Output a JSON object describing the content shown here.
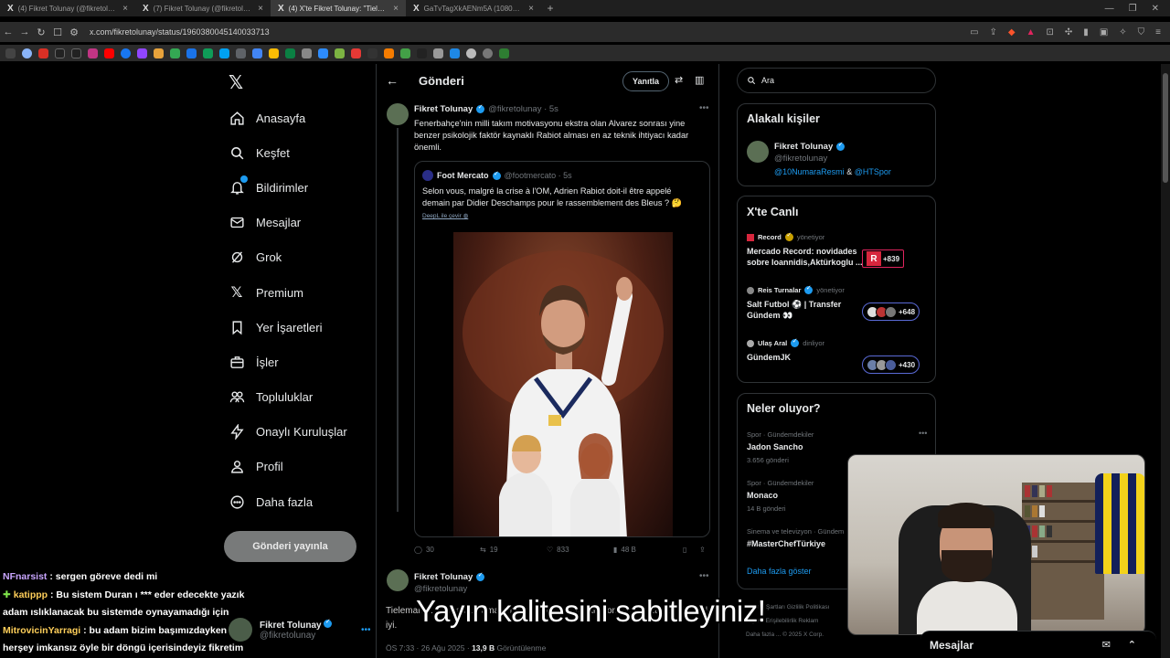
{
  "browser": {
    "tabs": [
      {
        "label": "(4) Fikret Tolunay (@fikretolunay) / X",
        "active": false
      },
      {
        "label": "(7) Fikret Tolunay (@fikretolunay) / X",
        "active": false
      },
      {
        "label": "(4) X'te Fikret Tolunay: \"Tieleman",
        "active": true
      },
      {
        "label": "GaTvTagXkAENm5A (1080×1350)",
        "active": false
      }
    ],
    "url": "x.com/fikretolunay/status/1960380045140033713"
  },
  "nav": {
    "items": [
      {
        "label": "Anasayfa",
        "icon": "home-icon"
      },
      {
        "label": "Keşfet",
        "icon": "search-icon"
      },
      {
        "label": "Bildirimler",
        "icon": "bell-icon"
      },
      {
        "label": "Mesajlar",
        "icon": "mail-icon"
      },
      {
        "label": "Grok",
        "icon": "grok-icon"
      },
      {
        "label": "Premium",
        "icon": "x-icon"
      },
      {
        "label": "Yer İşaretleri",
        "icon": "bookmark-icon"
      },
      {
        "label": "İşler",
        "icon": "briefcase-icon"
      },
      {
        "label": "Topluluklar",
        "icon": "people-icon"
      },
      {
        "label": "Onaylı Kuruluşlar",
        "icon": "lightning-icon"
      },
      {
        "label": "Profil",
        "icon": "person-icon"
      },
      {
        "label": "Daha fazla",
        "icon": "more-circle-icon"
      }
    ],
    "post_button": "Gönderi yayınla"
  },
  "account": {
    "name": "Fikret Tolunay",
    "handle": "@fikretolunay"
  },
  "header": {
    "title": "Gönderi",
    "reply_label": "Yanıtla"
  },
  "tweet": {
    "name": "Fikret Tolunay",
    "meta": "@fikretolunay · 5s",
    "text": "Fenerbahçe'nin milli takım motivasyonu ekstra olan Alvarez sonrası yine benzer psikolojik faktör kaynaklı Rabiot alması en az teknik ihtiyacı kadar önemli.",
    "quote": {
      "name": "Foot Mercato",
      "meta": "@footmercato · 5s",
      "text": "Selon vous, malgré la crise à l'OM, Adrien Rabiot doit-il être appelé demain par Didier Deschamps pour le rassemblement des Bleus ? 🤔",
      "deepl": "DeepL ile çevir"
    },
    "actions": {
      "replies": "30",
      "retweets": "19",
      "likes": "833",
      "views": "48 B"
    }
  },
  "tweet2": {
    "name": "Fikret Tolunay",
    "handle": "@fikretolunay",
    "text": "Tieleman ... Mercato ... ama anlatmaya çalıştığım aklıyor. Bence Rabiot olur o da iyi.",
    "time": "ÖS 7:33 · 26 Ağu 2025 ·",
    "views": "13,9 B",
    "views_label": "Görüntülenme"
  },
  "search": {
    "placeholder": "Ara"
  },
  "related": {
    "title": "Alakalı kişiler",
    "name": "Fikret Tolunay",
    "handle": "@fikretolunay",
    "link1": "@10NumaraResmi",
    "amp": "&",
    "link2": "@HTSpor"
  },
  "live": {
    "title": "X'te Canlı",
    "items": [
      {
        "host": "Record",
        "status": "yönetiyor",
        "title": "Mercado Record: novidades sobre Ioannidis,Aktürkoglu ...",
        "count": "+839"
      },
      {
        "host": "Reis Turnalar",
        "status": "yönetiyor",
        "title": "Salt Futbol ⚽ | Transfer Gündem 👀",
        "count": "+648"
      },
      {
        "host": "Ulaş Aral",
        "status": "dinliyor",
        "title": "GündemJK",
        "count": "+430"
      }
    ]
  },
  "trends": {
    "title": "Neler oluyor?",
    "items": [
      {
        "context": "Spor · Gündemdekiler",
        "title": "Jadon Sancho",
        "count": "3.656 gönderi"
      },
      {
        "context": "Spor · Gündemdekiler",
        "title": "Monaco",
        "count": "14 B gönderi"
      },
      {
        "context": "Sinema ve televizyon · Gündem",
        "title": "#MasterChefTürkiye",
        "count": ""
      }
    ],
    "show_more": "Daha fazla göster"
  },
  "footer": {
    "line1": "Hizmet Şartları   Gizlilik Politikası",
    "line2": "Imprint   Erişilebilirlik   Reklam",
    "line3": "Daha fazla ...   © 2025 X Corp."
  },
  "messages_dock": {
    "label": "Mesajlar"
  },
  "chat": [
    {
      "user": "NFnarsist",
      "text": " : sergen göreve dedi mi"
    },
    {
      "user": "katippp",
      "text": " : Bu sistem Duran ı *** eder edecekte yazık",
      "badge": "✚"
    },
    {
      "user": "",
      "text": "adam ıslıklanacak bu sistemde oynayamadığı için"
    },
    {
      "user": "MitrovicinYarragi",
      "text": " : bu adam bizim başımızdayken"
    },
    {
      "user": "",
      "text": "herşey imkansız öyle bir döngü içerisindeyiz fikretim"
    }
  ],
  "subtitle": "Yayın kalitesini sabitleyiniz!",
  "colors": {
    "accent": "#1d9bf0",
    "background": "#000000",
    "border": "#2f3336"
  }
}
